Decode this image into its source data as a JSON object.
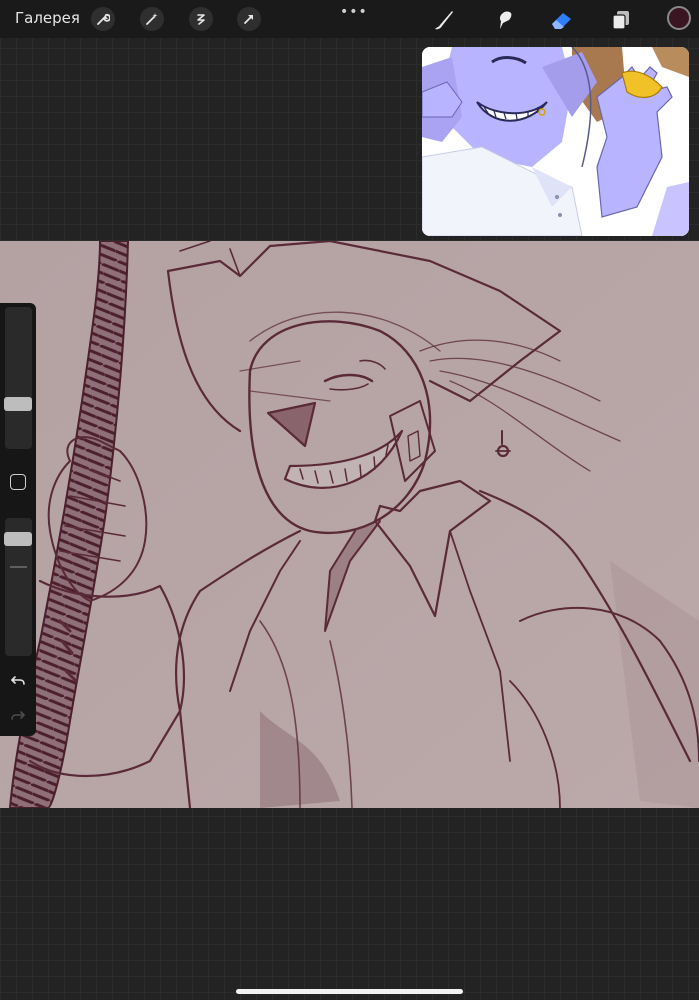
{
  "topbar": {
    "gallery_label": "Галерея",
    "left_tools": [
      "wrench-icon",
      "magic-wand-icon",
      "selection-icon",
      "transform-arrow-icon"
    ],
    "more_label": "•••",
    "right_tools": [
      "brush-icon",
      "smudge-icon",
      "eraser-icon",
      "layers-icon"
    ],
    "active_tool": "eraser-icon",
    "active_color": "#3a1622",
    "accent": "#2f7dff"
  },
  "reference": {
    "skin": "#b9b4ff",
    "shirt": "#f2f4fb",
    "accent": "#e2b100"
  },
  "canvas": {
    "paper": "#b9a6a7",
    "ink": "#5b2a38"
  },
  "sidebar": {
    "size_slider": 0.22,
    "opacity_slider": 0.1,
    "undo_icon": "undo-icon",
    "redo_icon": "redo-icon",
    "modify_icon": "square-icon"
  }
}
